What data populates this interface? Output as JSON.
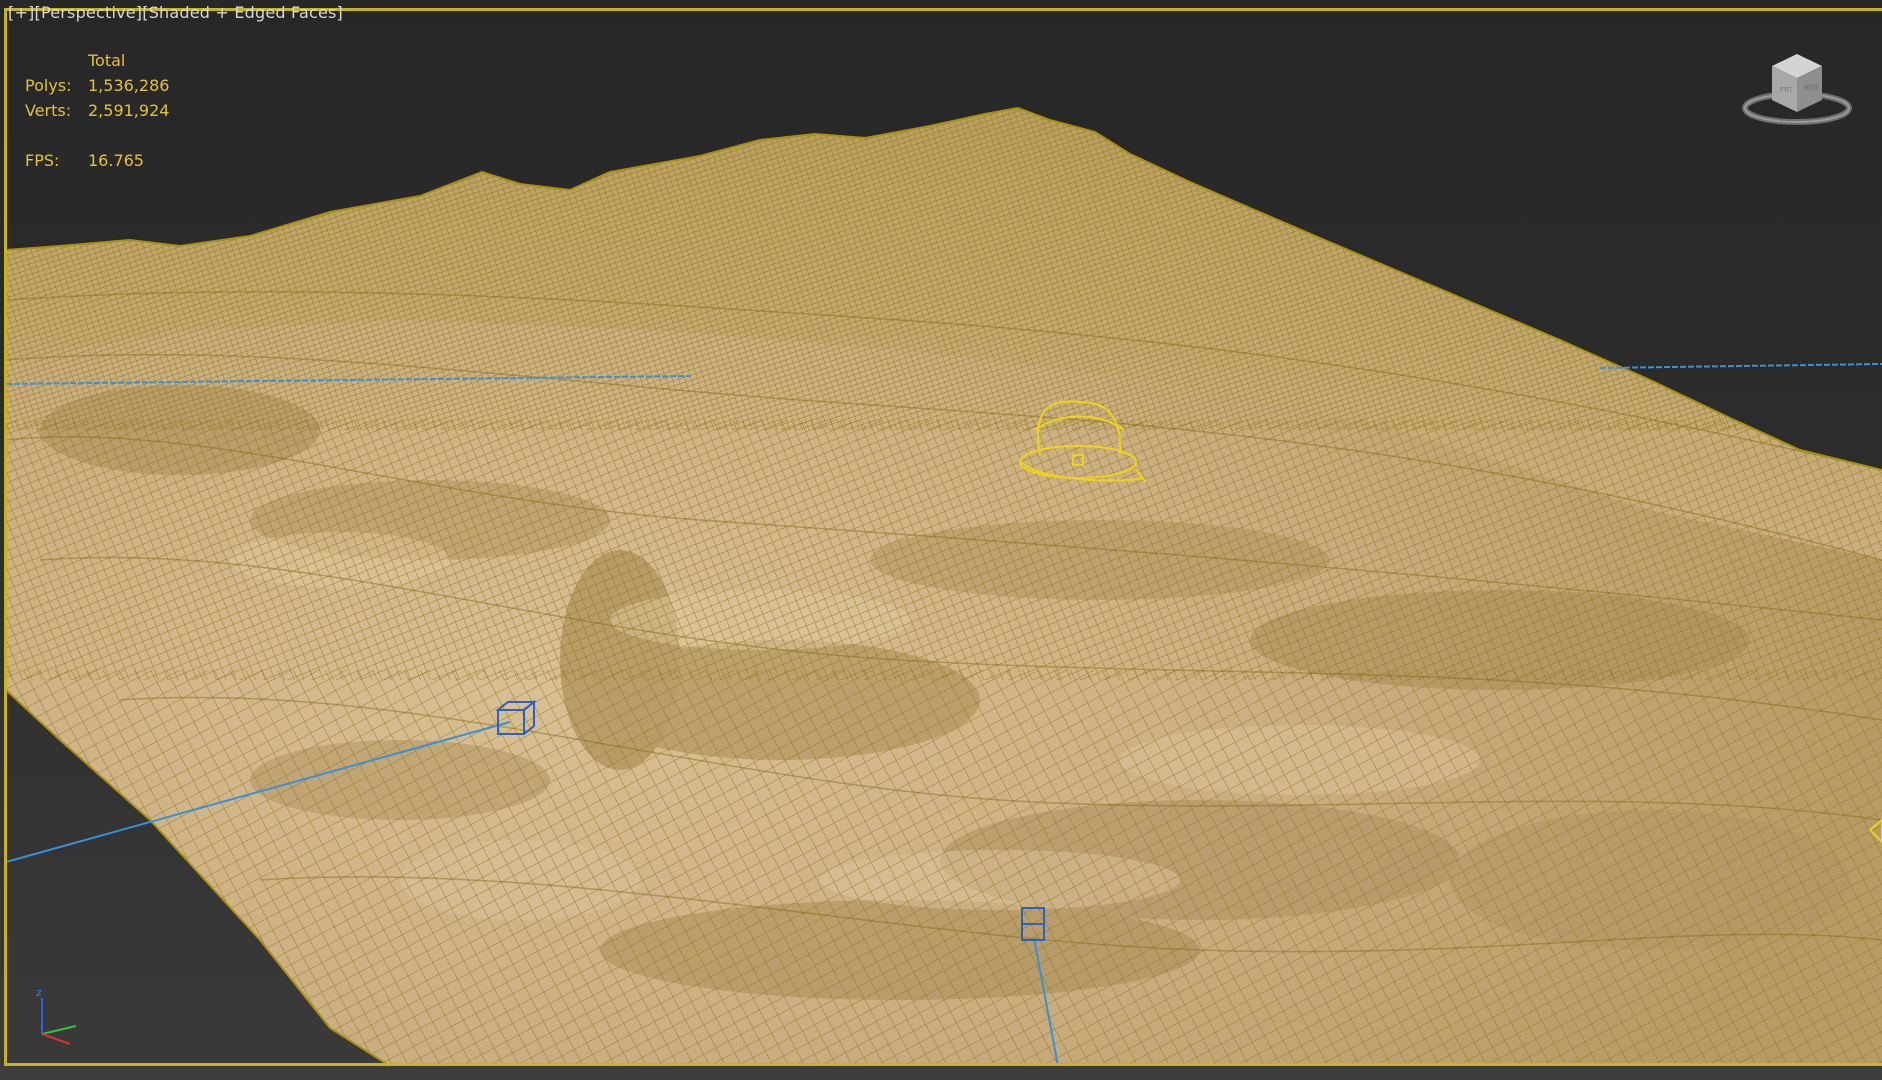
{
  "viewport": {
    "labels": [
      "[+]",
      "[Perspective]",
      "[Shaded + Edged Faces]"
    ]
  },
  "stats": {
    "header": "Total",
    "polys_label": "Polys:",
    "polys_value": "1,536,286",
    "verts_label": "Verts:",
    "verts_value": "2,591,924",
    "fps_label": "FPS:",
    "fps_value": "16.765"
  },
  "viewcube": {
    "icon": "viewcube-icon"
  },
  "axis": {
    "z": "z",
    "icon": "axis-tripod-icon"
  },
  "colors": {
    "frame": "#c8b222",
    "terrain_fill": "#cdb286",
    "wire": "#8f7a12",
    "helper_line": "#3b8fd6",
    "selection": "#f0d21e",
    "stats_text": "#e4c23a"
  }
}
